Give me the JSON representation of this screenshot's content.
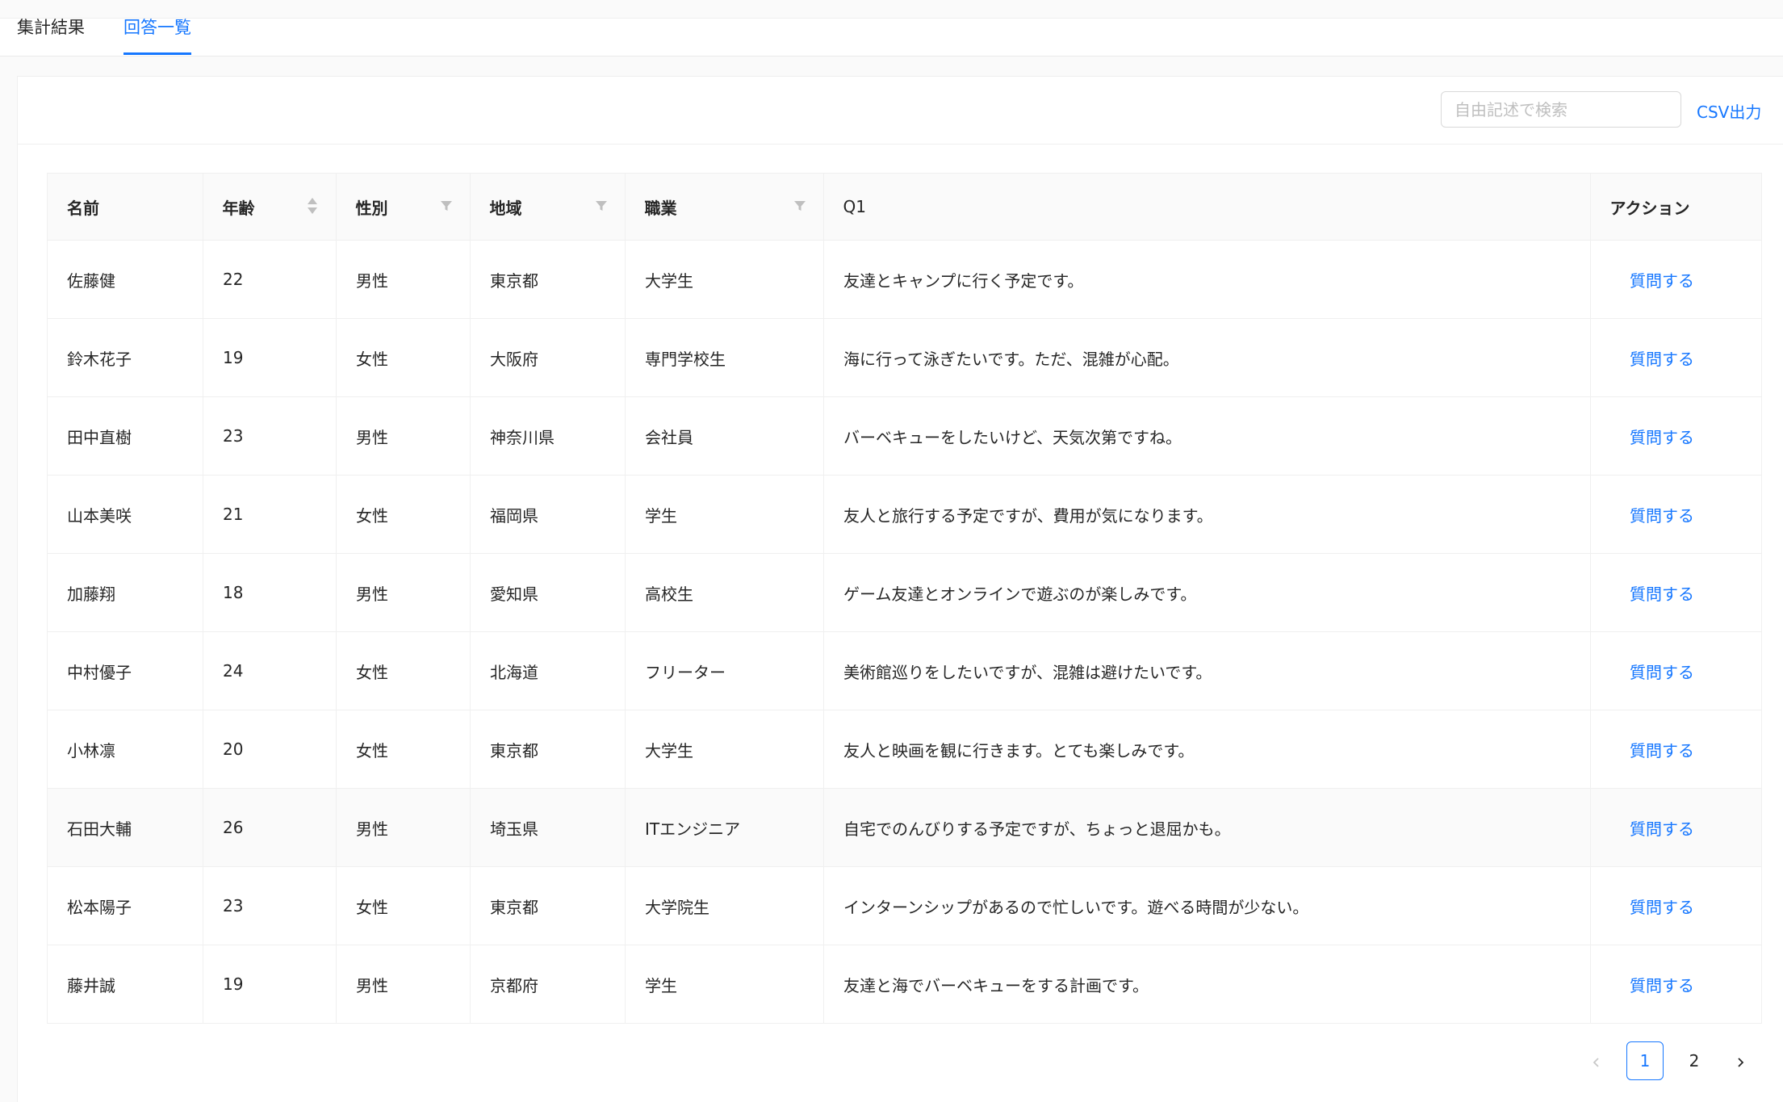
{
  "tabs": [
    {
      "label": "集計結果",
      "active": false
    },
    {
      "label": "回答一覧",
      "active": true
    }
  ],
  "toolbar": {
    "search_placeholder": "自由記述で検索",
    "search_value": "",
    "csv_label": "CSV出力"
  },
  "table": {
    "columns": [
      "名前",
      "年齢",
      "性別",
      "地域",
      "職業",
      "Q1",
      "アクション"
    ],
    "rows": [
      {
        "name": "佐藤健",
        "age": "22",
        "gender": "男性",
        "region": "東京都",
        "job": "大学生",
        "q1": "友達とキャンプに行く予定です。",
        "action": "質問する"
      },
      {
        "name": "鈴木花子",
        "age": "19",
        "gender": "女性",
        "region": "大阪府",
        "job": "専門学校生",
        "q1": "海に行って泳ぎたいです。ただ、混雑が心配。",
        "action": "質問する"
      },
      {
        "name": "田中直樹",
        "age": "23",
        "gender": "男性",
        "region": "神奈川県",
        "job": "会社員",
        "q1": "バーベキューをしたいけど、天気次第ですね。",
        "action": "質問する"
      },
      {
        "name": "山本美咲",
        "age": "21",
        "gender": "女性",
        "region": "福岡県",
        "job": "学生",
        "q1": "友人と旅行する予定ですが、費用が気になります。",
        "action": "質問する"
      },
      {
        "name": "加藤翔",
        "age": "18",
        "gender": "男性",
        "region": "愛知県",
        "job": "高校生",
        "q1": "ゲーム友達とオンラインで遊ぶのが楽しみです。",
        "action": "質問する"
      },
      {
        "name": "中村優子",
        "age": "24",
        "gender": "女性",
        "region": "北海道",
        "job": "フリーター",
        "q1": "美術館巡りをしたいですが、混雑は避けたいです。",
        "action": "質問する"
      },
      {
        "name": "小林凛",
        "age": "20",
        "gender": "女性",
        "region": "東京都",
        "job": "大学生",
        "q1": "友人と映画を観に行きます。とても楽しみです。",
        "action": "質問する"
      },
      {
        "name": "石田大輔",
        "age": "26",
        "gender": "男性",
        "region": "埼玉県",
        "job": "ITエンジニア",
        "q1": "自宅でのんびりする予定ですが、ちょっと退屈かも。",
        "action": "質問する"
      },
      {
        "name": "松本陽子",
        "age": "23",
        "gender": "女性",
        "region": "東京都",
        "job": "大学院生",
        "q1": "インターンシップがあるので忙しいです。遊べる時間が少ない。",
        "action": "質問する"
      },
      {
        "name": "藤井誠",
        "age": "19",
        "gender": "男性",
        "region": "京都府",
        "job": "学生",
        "q1": "友達と海でバーベキューをする計画です。",
        "action": "質問する"
      }
    ]
  },
  "pagination": {
    "prev_icon": "chevron-left-icon",
    "next_icon": "chevron-right-icon",
    "pages": [
      "1",
      "2"
    ],
    "current": "1"
  },
  "colors": {
    "accent": "#1677ff",
    "header_bg": "#fafafa",
    "border": "#f0f0f0"
  }
}
